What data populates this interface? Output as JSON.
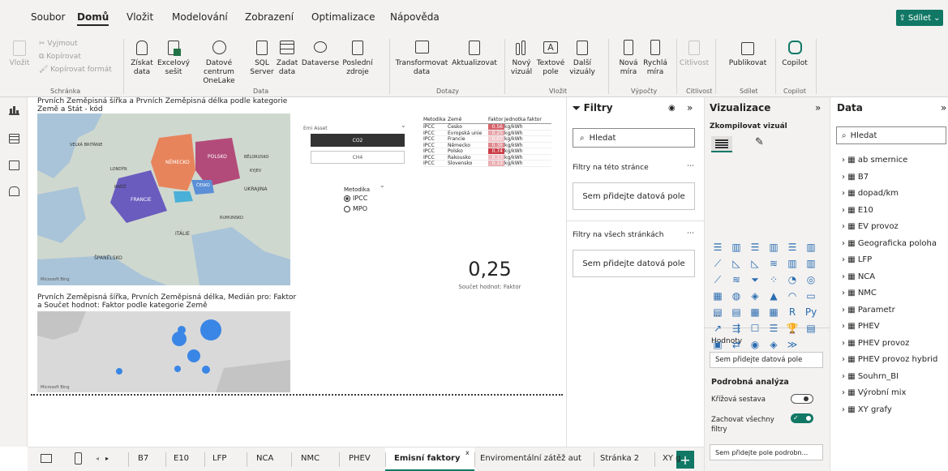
{
  "menu": {
    "tabs": [
      "Soubor",
      "Domů",
      "Vložit",
      "Modelování",
      "Zobrazení",
      "Optimalizace",
      "Nápověda"
    ],
    "share": "Sdílet"
  },
  "ribbon": {
    "clipboard": {
      "cut": "Vyjmout",
      "copy": "Kopírovat",
      "format": "Kopírovat formát",
      "paste": "Vložit",
      "group": "Schránka"
    },
    "data": {
      "get_data": [
        "Získat",
        "data"
      ],
      "excel": [
        "Excelový",
        "sešit"
      ],
      "datacenter": [
        "Datové centrum",
        "OneLake"
      ],
      "sql": [
        "SQL",
        "Server"
      ],
      "enter": [
        "Zadat",
        "data"
      ],
      "dataverse": "Dataverse",
      "recent": [
        "Poslední",
        "zdroje"
      ],
      "group": "Data"
    },
    "queries": {
      "transform": [
        "Transformovat",
        "data"
      ],
      "refresh": "Aktualizovat",
      "group": "Dotazy"
    },
    "insert": {
      "new_visual": [
        "Nový",
        "vizuál"
      ],
      "textbox": [
        "Textové",
        "pole"
      ],
      "more": [
        "Další",
        "vizuály"
      ],
      "group": "Vložit"
    },
    "calc": {
      "new_measure": [
        "Nová",
        "míra"
      ],
      "quick_measure": [
        "Rychlá",
        "míra"
      ],
      "group": "Výpočty"
    },
    "sensitivity": {
      "label": "Citlivost",
      "group": "Citlivost"
    },
    "share": {
      "publish": "Publikovat",
      "group": "Sdílet"
    },
    "copilot": {
      "label": "Copilot",
      "group": "Copilot"
    }
  },
  "canvas": {
    "map1_title": "Prvních Zeměpisná šířka a Prvních Zeměpisná délka podle kategorie Země a Stát - kód",
    "map2_title": "Prvních Zeměpisná šířka, Prvních Zeměpisná délka, Medián pro: Faktor a Součet hodnot: Faktor podle kategorie Země",
    "map_credit": "Microsoft Bing",
    "countries": [
      "NĚMECKO",
      "POLSKO",
      "FRANCIE",
      "ČESKO",
      "ITÁLIE",
      "ŠPANĚLSKO",
      "UKRAJINA",
      "RUMUNSKO",
      "BĚLORUSKO",
      "LONDÝN",
      "PAŘÍŽ",
      "KYJEV",
      "VELKÁ BRITÁNIE"
    ],
    "emission_slicer": {
      "label": "Emi Asset",
      "options": [
        "CO2",
        "CH4"
      ],
      "selected": "CO2"
    },
    "method": {
      "label": "Metodika",
      "options": [
        "IPCC",
        "MPO"
      ],
      "selected": "IPCC"
    },
    "table": {
      "headers": [
        "Metodika",
        "Země",
        "Faktor",
        "Jednotka faktor"
      ],
      "rows": [
        [
          "IPCC",
          "Česko",
          "0.56",
          "kg/kWh"
        ],
        [
          "IPCC",
          "Evropská unie",
          "0.25",
          "kg/kWh"
        ],
        [
          "IPCC",
          "Francie",
          "0.07",
          "kg/kWh"
        ],
        [
          "IPCC",
          "Německo",
          "0.38",
          "kg/kWh"
        ],
        [
          "IPCC",
          "Polsko",
          "0.74",
          "kg/kWh"
        ],
        [
          "IPCC",
          "Rakousko",
          "0.13",
          "kg/kWh"
        ],
        [
          "IPCC",
          "Slovensko",
          "0.19",
          "kg/kWh"
        ]
      ]
    },
    "kpi": {
      "value": "0,25",
      "label": "Součet hodnot: Faktor"
    }
  },
  "filters": {
    "title": "Filtry",
    "search": "Hledat",
    "page_label": "Filtry na této stránce",
    "all_label": "Filtry na všech stránkách",
    "drop": "Sem přidejte datová pole"
  },
  "viz": {
    "title": "Vizualizace",
    "build": "Zkompilovat vizuál",
    "values_label": "Hodnoty",
    "values_drop": "Sem přidejte datová pole",
    "drill": "Podrobná analýza",
    "cross": "Křížová sestava",
    "keep": [
      "Zachovat všechny",
      "filtry"
    ],
    "drill_drop": "Sem přidejte pole podrobn...",
    "more": "..."
  },
  "datapane": {
    "title": "Data",
    "search": "Hledat",
    "tables": [
      "ab smernice",
      "B7",
      "dopad/km",
      "E10",
      "EV provoz",
      "Geograficka poloha",
      "LFP",
      "NCA",
      "NMC",
      "Parametr",
      "PHEV",
      "PHEV provoz",
      "PHEV provoz hybrid",
      "Souhrn_BI",
      "Výrobní mix",
      "XY grafy"
    ]
  },
  "pages": {
    "tabs": [
      "B7",
      "E10",
      "LFP",
      "NCA",
      "NMC",
      "PHEV",
      "Emisní faktory",
      "Enviromentální zátěž aut",
      "Stránka 2",
      "XY g"
    ],
    "active": "Emisní faktory"
  },
  "colors": {
    "accent": "#117865",
    "ribbon": "#f3f2f1",
    "germany": "#e8845c",
    "poland": "#b34b7a",
    "france": "#6a5bbf",
    "czech": "#5b8fd6",
    "bubble": "#3a86e6"
  }
}
